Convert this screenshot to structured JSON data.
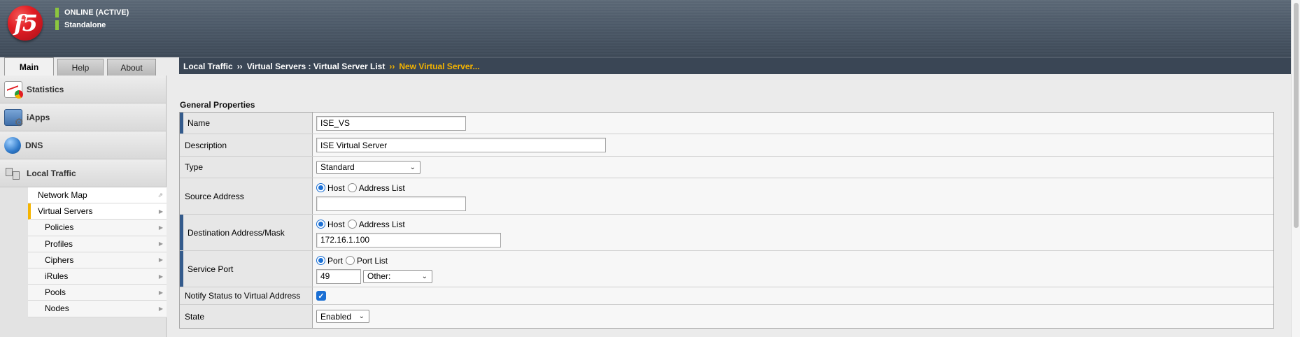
{
  "header": {
    "logo_text": "f5",
    "status_line1": "ONLINE (ACTIVE)",
    "status_line2": "Standalone",
    "status_color": "#8cc63f"
  },
  "tabs": [
    {
      "label": "Main",
      "active": true
    },
    {
      "label": "Help",
      "active": false
    },
    {
      "label": "About",
      "active": false
    }
  ],
  "breadcrumb": {
    "part1": "Local Traffic",
    "sep1": "››",
    "part2": "Virtual Servers : Virtual Server List",
    "sep2": "››",
    "current": "New Virtual Server...",
    "current_color": "#f5b400"
  },
  "sidebar": {
    "categories": [
      {
        "label": "Statistics",
        "icon": "statistics-icon"
      },
      {
        "label": "iApps",
        "icon": "iapps-icon"
      },
      {
        "label": "DNS",
        "icon": "dns-icon"
      },
      {
        "label": "Local Traffic",
        "icon": "local-traffic-icon"
      }
    ],
    "local_traffic_items": [
      {
        "label": "Network Map",
        "level": 1,
        "icon": "external-link-icon"
      },
      {
        "label": "Virtual Servers",
        "level": 1,
        "active": true
      },
      {
        "label": "Policies",
        "level": 2
      },
      {
        "label": "Profiles",
        "level": 2
      },
      {
        "label": "Ciphers",
        "level": 2
      },
      {
        "label": "iRules",
        "level": 2
      },
      {
        "label": "Pools",
        "level": 2
      },
      {
        "label": "Nodes",
        "level": 2
      }
    ]
  },
  "form": {
    "section_title": "General Properties",
    "name_label": "Name",
    "name_value": "ISE_VS",
    "description_label": "Description",
    "description_value": "ISE Virtual Server",
    "type_label": "Type",
    "type_value": "Standard",
    "source_label": "Source Address",
    "source_opt_host": "Host",
    "source_opt_list": "Address List",
    "source_selected": "Host",
    "source_value": "",
    "dest_label": "Destination Address/Mask",
    "dest_opt_host": "Host",
    "dest_opt_list": "Address List",
    "dest_selected": "Host",
    "dest_value": "172.16.1.100",
    "port_label": "Service Port",
    "port_opt_port": "Port",
    "port_opt_list": "Port List",
    "port_selected": "Port",
    "port_value": "49",
    "port_type_value": "Other:",
    "notify_label": "Notify Status to Virtual Address",
    "notify_checked": true,
    "state_label": "State",
    "state_value": "Enabled"
  },
  "accent_color": "#345b8c"
}
